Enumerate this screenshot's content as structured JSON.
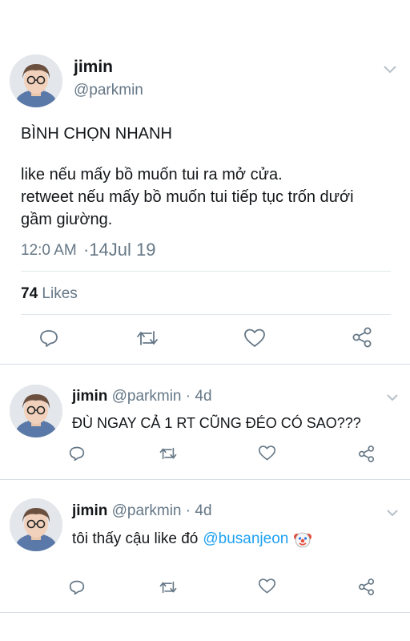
{
  "main_tweet": {
    "name": "jimin",
    "handle": "@parkmin",
    "text_line1": "BÌNH CHỌN NHANH",
    "text_line2": "like nếu mấy bồ muốn tui ra mở cửa.",
    "text_line3": "retweet nếu mấy bồ muốn tui tiếp tục trốn dưới",
    "text_line4": "gầm giường.",
    "time": "12:0 AM",
    "date": "·14Jul 19",
    "likes_count": "74",
    "likes_label": "Likes"
  },
  "replies": [
    {
      "name": "jimin",
      "handle": "@parkmin · 4d",
      "text": "ĐÙ NGAY CẢ 1 RT CŨNG ĐÉO CÓ SAO???"
    },
    {
      "name": "jimin",
      "handle": "@parkmin · 4d",
      "text": "tôi thấy cậu like đó",
      "mention": "@busanjeon"
    }
  ],
  "colors": {
    "accent": "#1da1f2",
    "icon": "#657786",
    "divider": "#e1e8ed"
  },
  "icons": [
    "reply-icon",
    "retweet-icon",
    "like-icon",
    "share-icon",
    "chevron-down-icon",
    "clown-emoji-icon"
  ]
}
